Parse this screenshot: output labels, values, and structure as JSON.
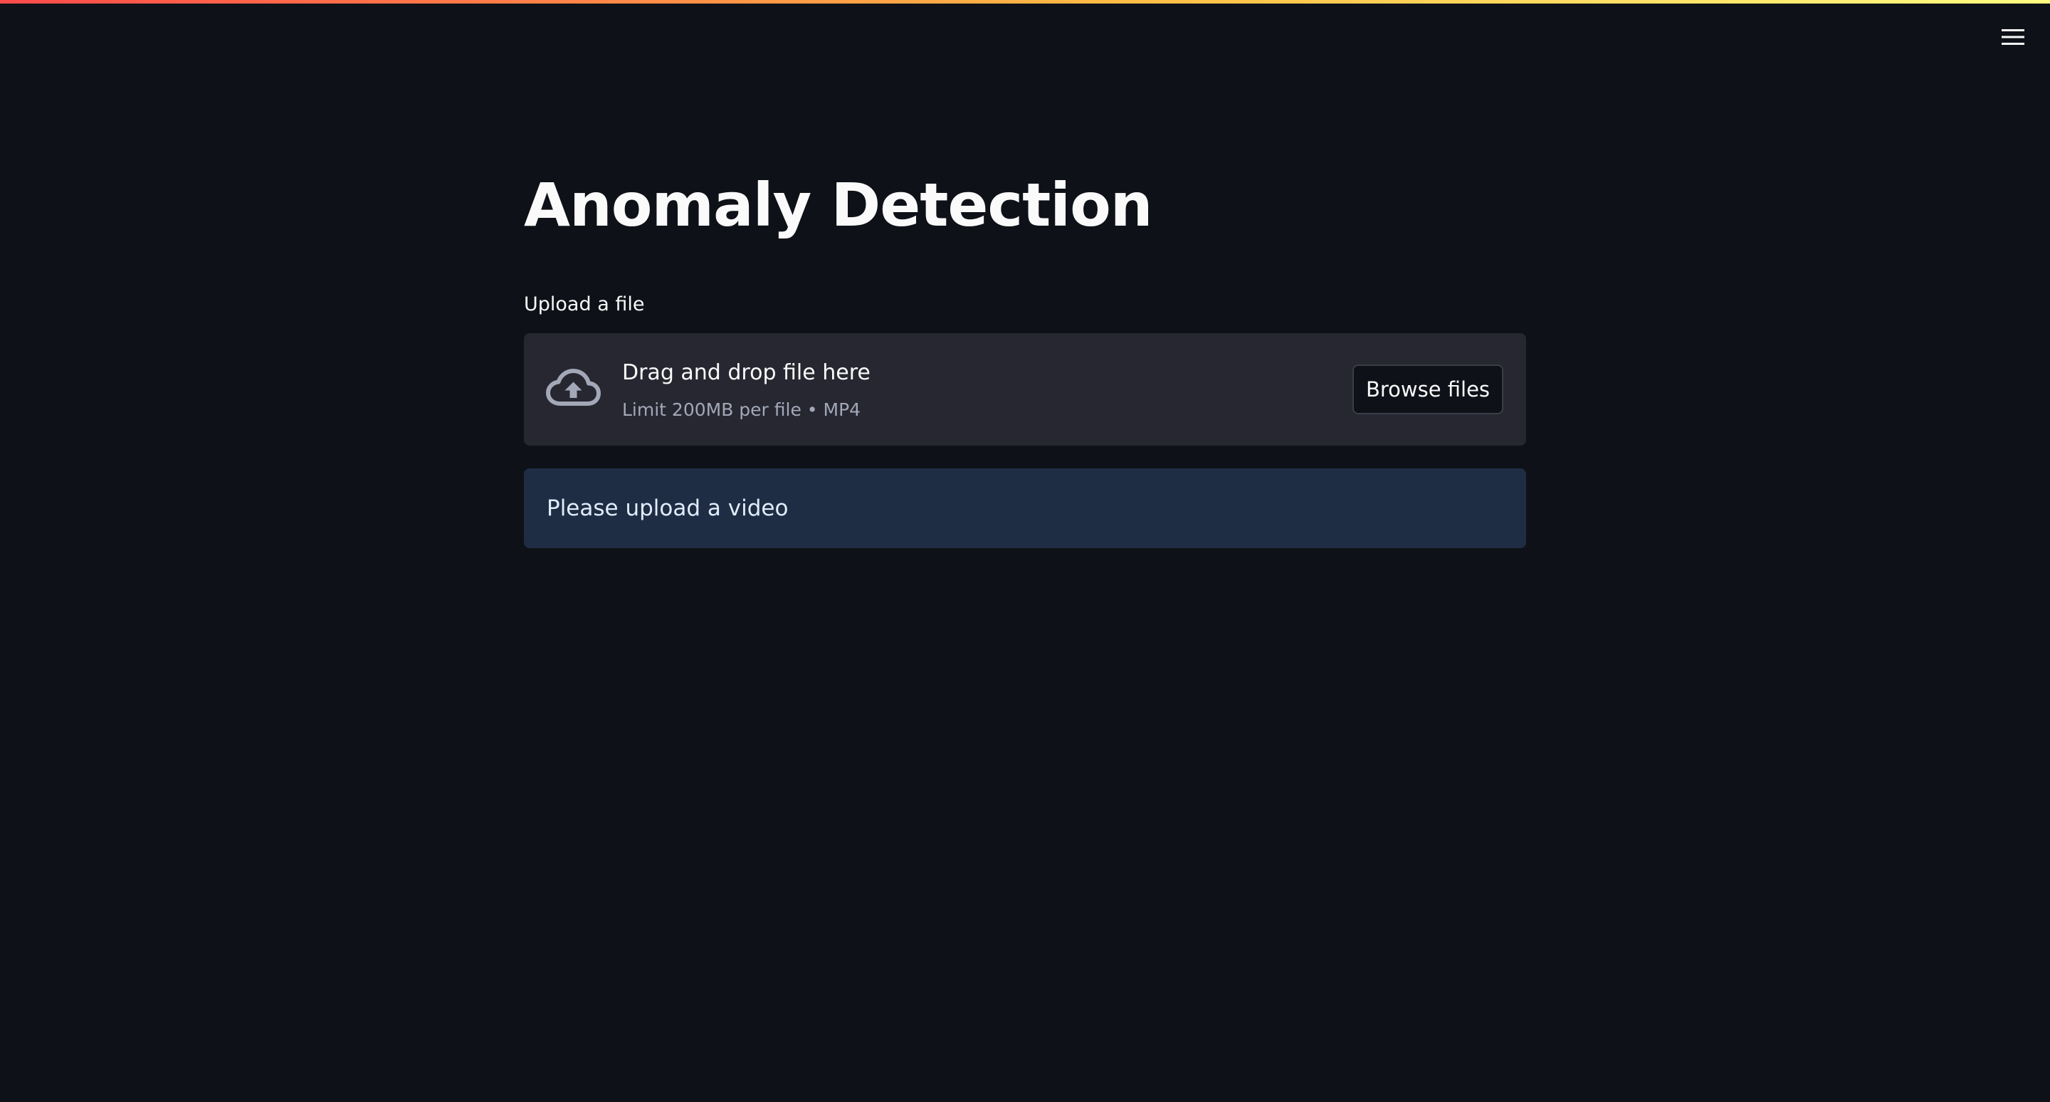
{
  "app": {
    "title": "Anomaly Detection"
  },
  "header": {
    "menu_icon": "hamburger-menu-icon"
  },
  "uploader": {
    "label": "Upload a file",
    "drop_text": "Drag and drop file here",
    "limit_text": "Limit 200MB per file • MP4",
    "button_label": "Browse files",
    "icon": "cloud-upload-icon"
  },
  "info": {
    "message": "Please upload a video"
  },
  "colors": {
    "background": "#0e1117",
    "dropzone": "#262730",
    "info_background": "#1f2d44",
    "text": "#fafafa",
    "muted_text": "#a3a8b8"
  }
}
